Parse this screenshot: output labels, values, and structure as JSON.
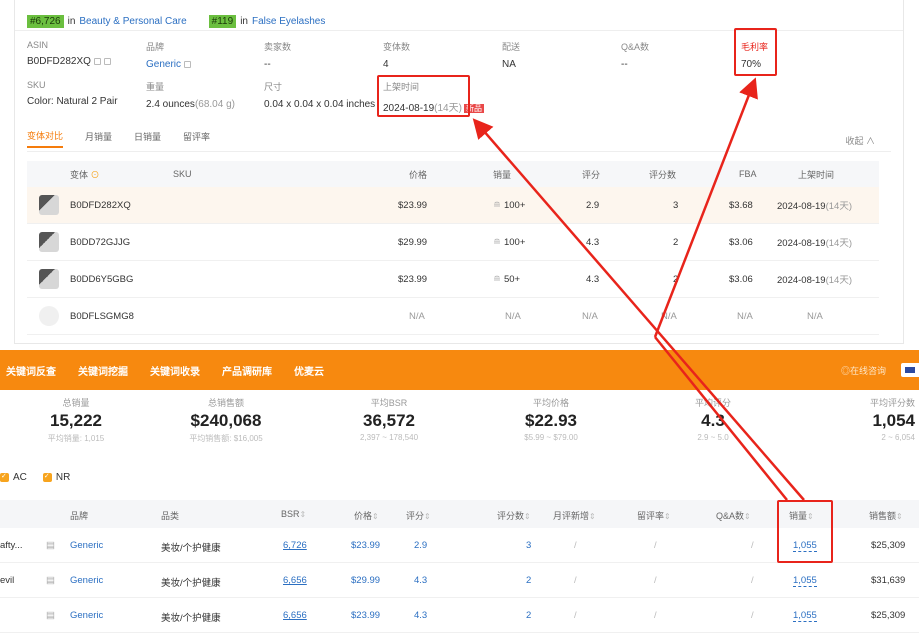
{
  "product": {
    "rank_main": "#6,726",
    "rank_in": "in",
    "category_main": "Beauty & Personal Care",
    "rank_sub": "#119",
    "category_sub": "False Eyelashes",
    "info": {
      "asin_label": "ASIN",
      "asin_value": "B0DFD282XQ",
      "brand_label": "品牌",
      "brand_value": "Generic",
      "sellers_label": "卖家数",
      "sellers_value": "--",
      "variants_label": "变体数",
      "variants_value": "4",
      "delivery_label": "配送",
      "delivery_value": "NA",
      "qa_label": "Q&A数",
      "qa_value": "--",
      "margin_label": "毛利率",
      "margin_value": "70%",
      "sku_label": "SKU",
      "sku_value": "Color: Natural 2 Pair",
      "weight_label": "重量",
      "weight_value": "2.4 ounces",
      "weight_alt": "(68.04 g)",
      "size_label": "尺寸",
      "size_value": "0.04 x 0.04 x 0.04 inches",
      "listed_label": "上架时间",
      "listed_value": "2024-08-19",
      "listed_days": "(14天)",
      "new_tag": "新品"
    },
    "tabs": [
      "变体对比",
      "月销量",
      "日销量",
      "留评率"
    ],
    "collapse_label": "收起 ∧",
    "variant_headers": {
      "variant": "变体",
      "sku": "SKU",
      "price": "价格",
      "sales": "销量",
      "rating": "评分",
      "reviews": "评分数",
      "fba": "FBA",
      "listed": "上架时间"
    },
    "variants": [
      {
        "asin": "B0DFD282XQ",
        "price": "$23.99",
        "sales": "100+",
        "rating": "2.9",
        "reviews": "3",
        "fba": "$3.68",
        "listed": "2024-08-19",
        "days": "(14天)"
      },
      {
        "asin": "B0DD72GJJG",
        "price": "$29.99",
        "sales": "100+",
        "rating": "4.3",
        "reviews": "2",
        "fba": "$3.06",
        "listed": "2024-08-19",
        "days": "(14天)"
      },
      {
        "asin": "B0DD6Y5GBG",
        "price": "$23.99",
        "sales": "50+",
        "rating": "4.3",
        "reviews": "2",
        "fba": "$3.06",
        "listed": "2024-08-19",
        "days": "(14天)"
      },
      {
        "asin": "B0DFLSGMG8",
        "price": "N/A",
        "sales": "N/A",
        "rating": "N/A",
        "reviews": "N/A",
        "fba": "N/A",
        "listed": "N/A",
        "days": ""
      }
    ]
  },
  "toolbar": {
    "items": [
      "关键词反查",
      "关键词挖掘",
      "关键词收录",
      "产品调研库",
      "优麦云"
    ],
    "right_label": "◎在线咨询"
  },
  "stats": [
    {
      "label": "总销量",
      "value": "15,222",
      "sub": "平均销量: 1,015"
    },
    {
      "label": "总销售额",
      "value": "$240,068",
      "sub": "平均销售额: $16,005"
    },
    {
      "label": "平均BSR",
      "value": "36,572",
      "sub": "2,397 ~ 178,540"
    },
    {
      "label": "平均价格",
      "value": "$22.93",
      "sub": "$5.99 ~ $79.00"
    },
    {
      "label": "平均评分",
      "value": "4.3",
      "sub": "2.9 ~ 5.0"
    },
    {
      "label": "平均评分数",
      "value": "1,054",
      "sub": "2 ~ 6,054"
    }
  ],
  "filters": [
    "AC",
    "NR"
  ],
  "table": {
    "headers": {
      "brand": "品牌",
      "category": "品类",
      "bsr": "BSR",
      "price": "价格",
      "rating": "评分",
      "reviews": "评分数",
      "monthly_new": "月评新增",
      "review_rate": "留评率",
      "qa": "Q&A数",
      "sales": "销量",
      "revenue": "销售额"
    },
    "rows": [
      {
        "seller": "afty...",
        "brand": "Generic",
        "category": "美妆/个护健康",
        "bsr": "6,726",
        "price": "$23.99",
        "rating": "2.9",
        "reviews": "3",
        "monthly_new": "/",
        "review_rate": "/",
        "qa": "/",
        "sales": "1,055",
        "revenue": "$25,309"
      },
      {
        "seller": "evil",
        "brand": "Generic",
        "category": "美妆/个护健康",
        "bsr": "6,656",
        "price": "$29.99",
        "rating": "4.3",
        "reviews": "2",
        "monthly_new": "/",
        "review_rate": "/",
        "qa": "/",
        "sales": "1,055",
        "revenue": "$31,639"
      },
      {
        "seller": "",
        "brand": "Generic",
        "category": "美妆/个护健康",
        "bsr": "6,656",
        "price": "$23.99",
        "rating": "4.3",
        "reviews": "2",
        "monthly_new": "/",
        "review_rate": "/",
        "qa": "/",
        "sales": "1,055",
        "revenue": "$25,309"
      }
    ]
  },
  "colors": {
    "accent": "#f7890f",
    "link": "#2b6fc2",
    "annotation": "#e8241b",
    "rank_badge": "#6bbf3f"
  }
}
